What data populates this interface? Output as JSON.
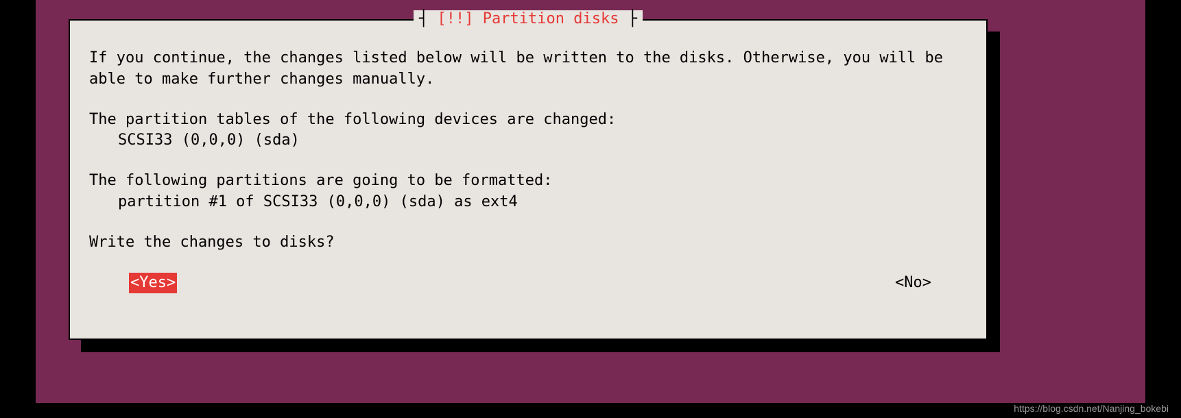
{
  "dialog": {
    "title": "[!!] Partition disks",
    "intro": "If you continue, the changes listed below will be written to the disks. Otherwise, you will be able to make further changes manually.",
    "tables_changed_header": "The partition tables of the following devices are changed:",
    "tables_changed_items": [
      "SCSI33 (0,0,0) (sda)"
    ],
    "formatted_header": "The following partitions are going to be formatted:",
    "formatted_items": [
      "partition #1 of SCSI33 (0,0,0) (sda) as ext4"
    ],
    "question": "Write the changes to disks?",
    "yes_label": "<Yes>",
    "no_label": "<No>"
  },
  "watermark": "https://blog.csdn.net/Nanjing_bokebi"
}
